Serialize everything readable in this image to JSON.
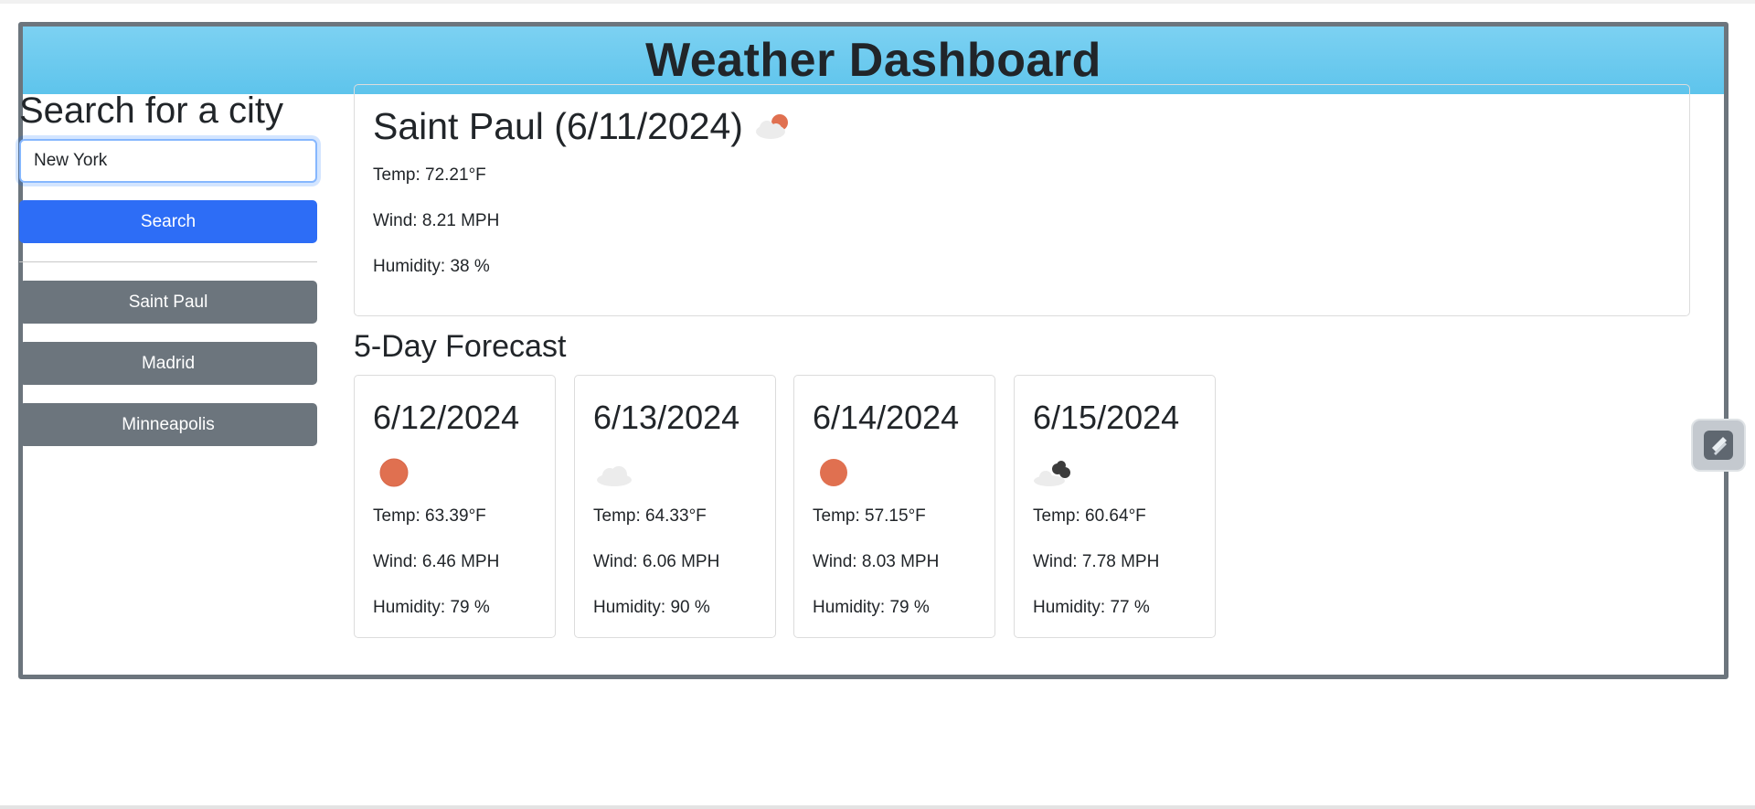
{
  "header": {
    "title": "Weather Dashboard"
  },
  "sidebar": {
    "heading": "Search for a city",
    "search_value": "New York",
    "search_button": "Search",
    "history": [
      "Saint Paul",
      "Madrid",
      "Minneapolis"
    ]
  },
  "current": {
    "title": "Saint Paul (6/11/2024)",
    "icon": "partly-cloudy-day-icon",
    "temp": "Temp: 72.21°F",
    "wind": "Wind: 8.21 MPH",
    "humidity": "Humidity: 38 %"
  },
  "forecast": {
    "heading": "5-Day Forecast",
    "days": [
      {
        "date": "6/12/2024",
        "icon": "sun-icon",
        "temp": "Temp: 63.39°F",
        "wind": "Wind: 6.46 MPH",
        "humidity": "Humidity: 79 %"
      },
      {
        "date": "6/13/2024",
        "icon": "cloud-icon",
        "temp": "Temp: 64.33°F",
        "wind": "Wind: 6.06 MPH",
        "humidity": "Humidity: 90 %"
      },
      {
        "date": "6/14/2024",
        "icon": "sun-icon",
        "temp": "Temp: 57.15°F",
        "wind": "Wind: 8.03 MPH",
        "humidity": "Humidity: 79 %"
      },
      {
        "date": "6/15/2024",
        "icon": "broken-clouds-icon",
        "temp": "Temp: 60.64°F",
        "wind": "Wind: 7.78 MPH",
        "humidity": "Humidity: 77 %"
      }
    ]
  },
  "colors": {
    "header_bg": "#5ec4ec",
    "primary": "#2d6df6",
    "secondary": "#6c757d",
    "sun": "#e07050"
  },
  "side_widget_icon": "extension-icon"
}
